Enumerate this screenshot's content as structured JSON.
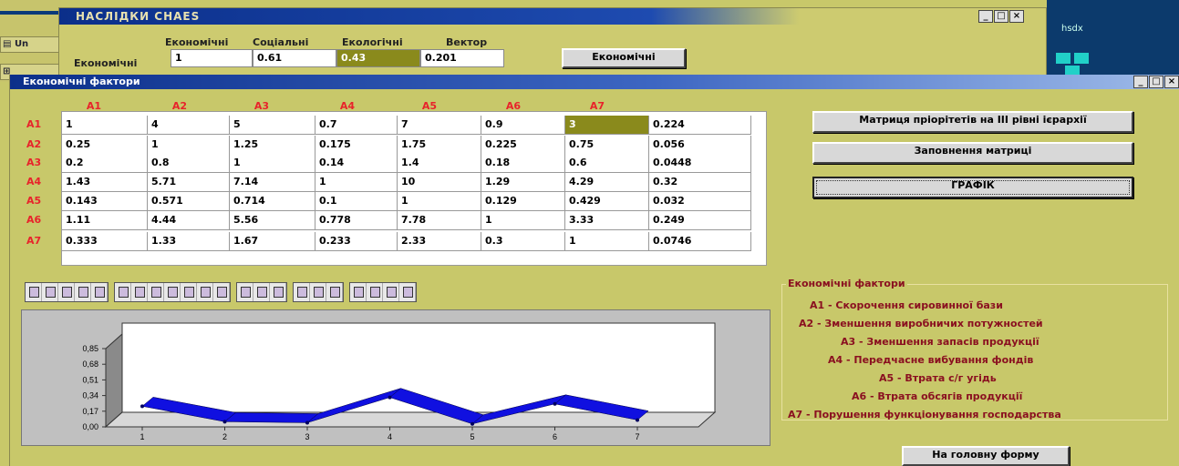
{
  "back_window": {
    "title": "НАСЛІДКИ   CHAES",
    "left_items": [
      "Un",
      ""
    ],
    "right_label": "hsdx",
    "col_headers": [
      "Економічні",
      "Соціальні",
      "Екологічні",
      "Вектор"
    ],
    "row_label": "Економічні",
    "row_values": [
      "1",
      "0.61",
      "0.43",
      "0.201"
    ],
    "button_label": "Економічні",
    "win_buttons": [
      "_",
      "□",
      "×"
    ]
  },
  "window": {
    "title": "Економічні фактори",
    "win_buttons": [
      "_",
      "□",
      "×"
    ]
  },
  "matrix": {
    "col_headers": [
      "A1",
      "A2",
      "A3",
      "A4",
      "A5",
      "A6",
      "A7"
    ],
    "row_headers": [
      "A1",
      "A2",
      "A3",
      "A4",
      "A5",
      "A6",
      "A7"
    ],
    "rows": [
      [
        "1",
        "4",
        "5",
        "0.7",
        "7",
        "0.9",
        "3",
        "0.224"
      ],
      [
        "0.25",
        "1",
        "1.25",
        "0.175",
        "1.75",
        "0.225",
        "0.75",
        "0.056"
      ],
      [
        "0.2",
        "0.8",
        "1",
        "0.14",
        "1.4",
        "0.18",
        "0.6",
        "0.0448"
      ],
      [
        "1.43",
        "5.71",
        "7.14",
        "1",
        "10",
        "1.29",
        "4.29",
        "0.32"
      ],
      [
        "0.143",
        "0.571",
        "0.714",
        "0.1",
        "1",
        "0.129",
        "0.429",
        "0.032"
      ],
      [
        "1.11",
        "4.44",
        "5.56",
        "0.778",
        "7.78",
        "1",
        "3.33",
        "0.249"
      ],
      [
        "0.333",
        "1.33",
        "1.67",
        "0.233",
        "2.33",
        "0.3",
        "1",
        "0.0746"
      ]
    ],
    "selected": {
      "row": 0,
      "col": 6
    }
  },
  "buttons": {
    "priority": "Матриця пріорітетів на ІІІ рівні ієрархії",
    "fill": "Заповнення матриці",
    "graph": "ГРАФІК",
    "home": "На головну форму"
  },
  "chart_data": {
    "type": "line",
    "x": [
      1,
      2,
      3,
      4,
      5,
      6,
      7
    ],
    "series": [
      {
        "values": [
          0.224,
          0.056,
          0.0448,
          0.32,
          0.032,
          0.249,
          0.0746
        ]
      }
    ],
    "ylim": [
      0,
      0.85
    ],
    "yticks": [
      "0,00",
      "0,17",
      "0,34",
      "0,51",
      "0,68",
      "0,85"
    ],
    "xticks": [
      "1",
      "2",
      "3",
      "4",
      "5",
      "6",
      "7"
    ],
    "style": "3d-ribbon",
    "color": "#1010e0"
  },
  "legend": {
    "title": "Економічні  фактори",
    "items": [
      "A1 - Скорочення сировинної бази",
      "A2 - Зменшення виробничих потужностей",
      "A3 - Зменшення запасів продукції",
      "A4 - Передчасне вибування фондів",
      "A5 - Втрата  с/г  угідь",
      "A6 -  Втрата обсягів продукції",
      "A7 -  Порушення функціонування господарства"
    ]
  },
  "toolbar_icons": [
    [
      "save-icon",
      "open-icon",
      "camera-icon",
      "cut-icon",
      "print-icon"
    ],
    [
      "area-chart-icon",
      "bar-chart-icon",
      "column-chart-icon",
      "line-chart-icon",
      "scatter-chart-icon",
      "pie-chart-icon",
      "surface-chart-icon"
    ],
    [
      "3d-toggle-icon",
      "rotate-icon",
      "perspective-icon"
    ],
    [
      "legend-icon",
      "grid-icon",
      "gallery-icon"
    ],
    [
      "data-label-icon",
      "zoom-icon",
      "title-icon",
      "magnify-icon"
    ]
  ]
}
